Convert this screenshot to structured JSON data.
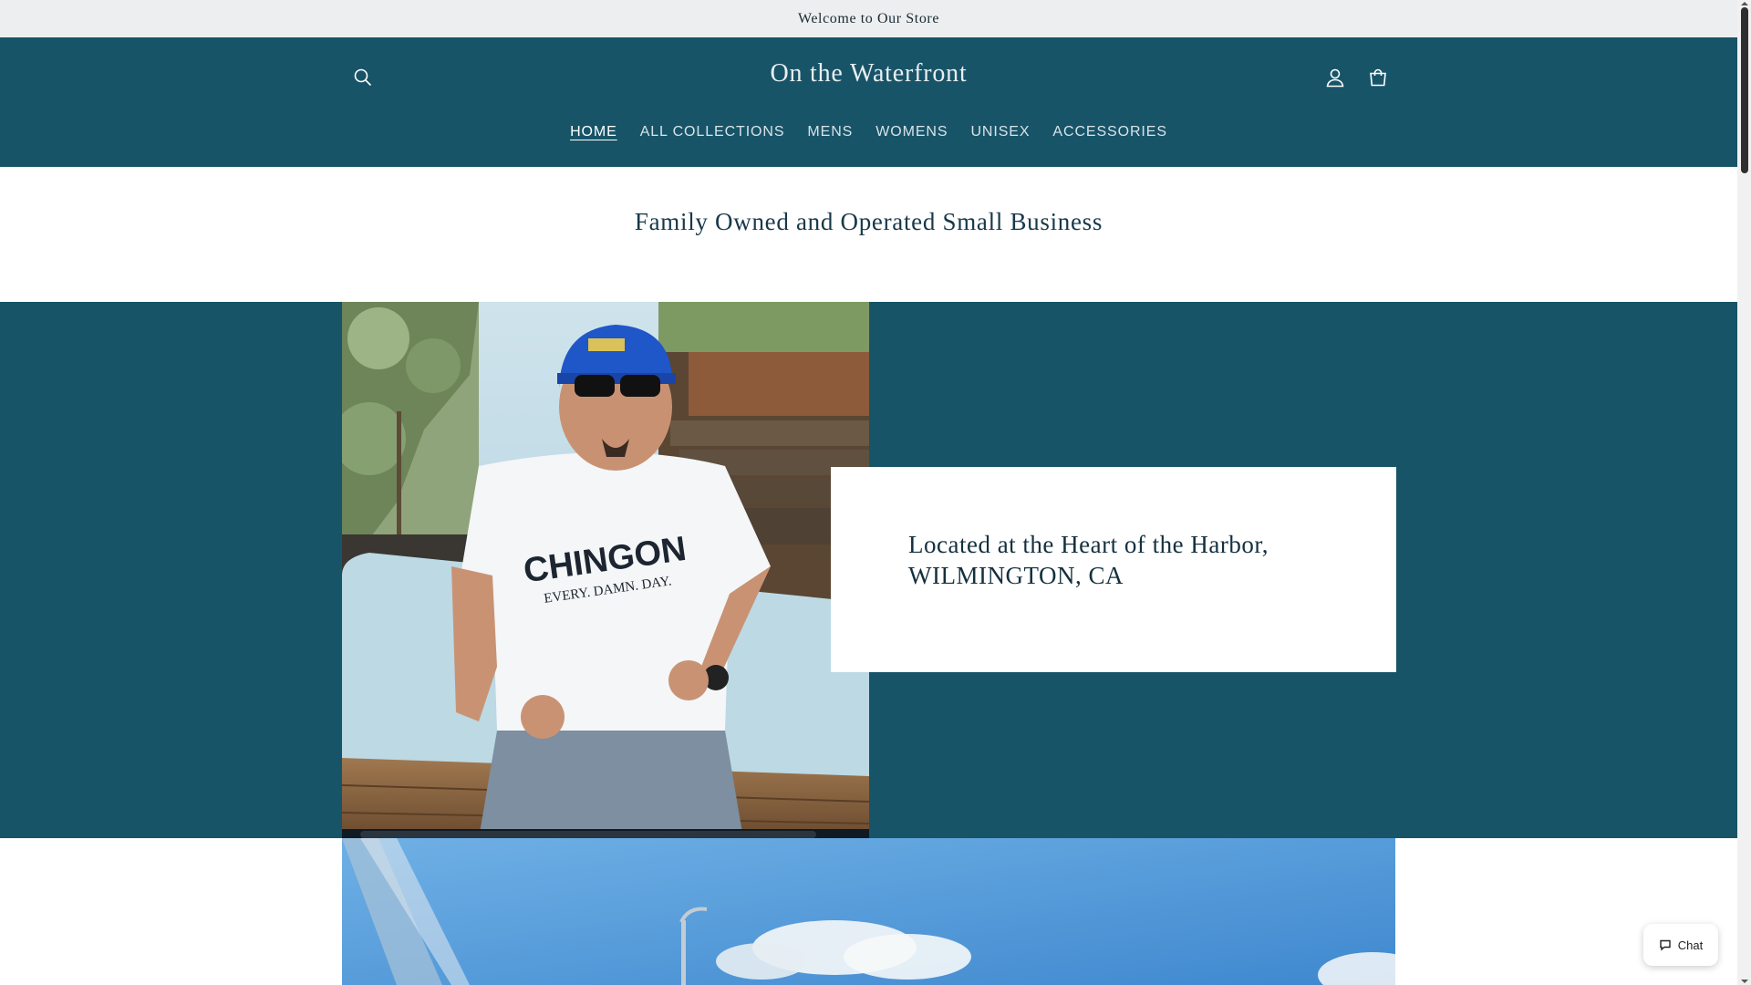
{
  "announcement": {
    "text": "Welcome to Our Store"
  },
  "header": {
    "logo": "On the Waterfront",
    "icons": {
      "search": "search-icon",
      "account": "account-icon",
      "cart": "cart-icon"
    }
  },
  "nav": {
    "items": [
      {
        "label": "HOME",
        "active": true
      },
      {
        "label": "ALL COLLECTIONS"
      },
      {
        "label": "MENS"
      },
      {
        "label": "WOMENS"
      },
      {
        "label": "UNISEX"
      },
      {
        "label": "ACCESSORIES"
      }
    ]
  },
  "tagline": "Family Owned and Operated Small Business",
  "feature": {
    "heading": "Located at the Heart of the Harbor, WILMINGTON, CA",
    "shirt_text_1": "CHINGON",
    "shirt_text_2": "EVERY. DAMN. DAY."
  },
  "chat": {
    "label": "Chat",
    "icon": "chat-icon"
  },
  "colors": {
    "header_bg": "#185468",
    "announcement_bg": "#eceeef",
    "text_dark": "#18384a"
  }
}
